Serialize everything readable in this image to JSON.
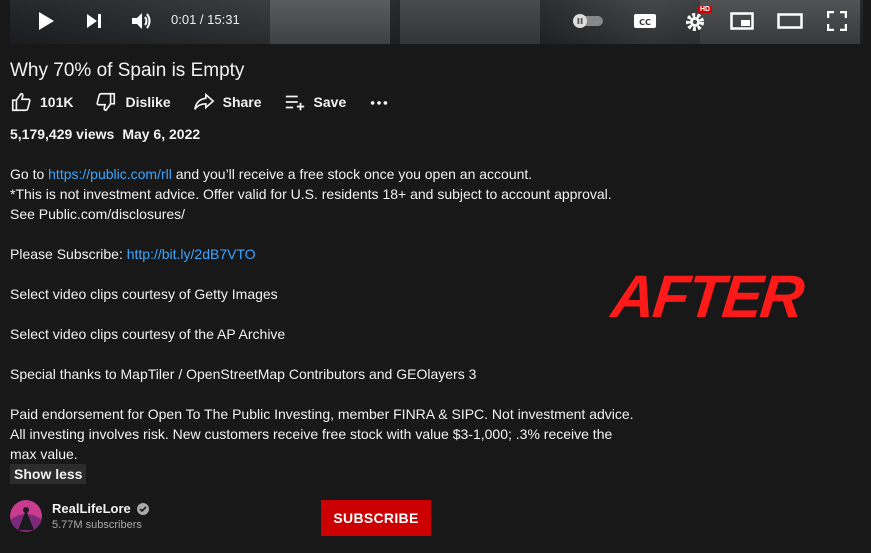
{
  "player": {
    "time_display": "0:01 / 15:31",
    "quality_badge": "HD"
  },
  "video": {
    "title": "Why 70% of Spain is Empty",
    "likes": "101K",
    "dislike_label": "Dislike",
    "share_label": "Share",
    "save_label": "Save",
    "views": "5,179,429 views",
    "date": "May 6, 2022"
  },
  "description": {
    "line1_prefix": "Go to ",
    "line1_link": "https://public.com/rll",
    "line1_suffix": " and you’ll receive a free stock once you open an account.",
    "line2": "*This is not investment advice. Offer valid for U.S. residents 18+ and subject to account approval.",
    "line3": "See Public.com/disclosures/",
    "subscribe_prefix": "Please Subscribe: ",
    "subscribe_link": "http://bit.ly/2dB7VTO",
    "getty": "Select video clips courtesy of Getty Images",
    "ap": "Select video clips courtesy of the AP Archive",
    "thanks": "Special thanks to MapTiler / OpenStreetMap Contributors and GEOlayers 3",
    "paid1": "Paid endorsement for Open To The Public Investing, member FINRA & SIPC. Not investment advice.",
    "paid2": "All investing involves risk. New customers receive free stock with value $3-1,000; .3% receive the",
    "paid3": "max value.",
    "show_less": "Show less"
  },
  "overlay": {
    "after_text": "AFTER"
  },
  "channel": {
    "name": "RealLifeLore",
    "subscribers": "5.77M subscribers",
    "subscribe_label": "SUBSCRIBE"
  },
  "colors": {
    "accent_link": "#3ea6ff",
    "subscribe_red": "#cc0000",
    "after_red": "#ff1a1a"
  }
}
